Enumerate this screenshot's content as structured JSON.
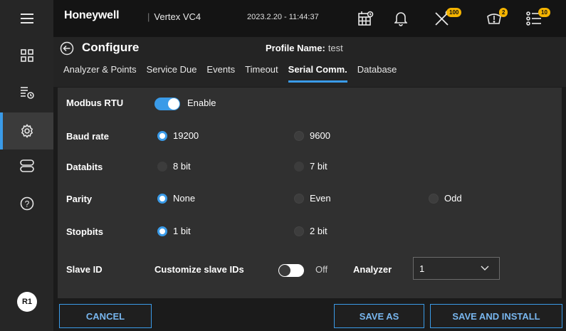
{
  "topbar": {
    "brand": "Honeywell",
    "model": "Vertex VC4",
    "datetime": "2023.2.20 - 11:44:37",
    "badges": {
      "tools": "100",
      "alarm": "2",
      "list": "10"
    }
  },
  "header": {
    "title": "Configure",
    "profile_label": "Profile Name:",
    "profile_value": "test",
    "tabs": [
      {
        "label": "Analyzer & Points"
      },
      {
        "label": "Service Due"
      },
      {
        "label": "Events"
      },
      {
        "label": "Timeout"
      },
      {
        "label": "Serial Comm.",
        "active": true
      },
      {
        "label": "Database"
      }
    ]
  },
  "form": {
    "modbus": {
      "label": "Modbus RTU",
      "toggle_state": "on",
      "toggle_label": "Enable"
    },
    "baud": {
      "label": "Baud rate",
      "options": [
        "19200",
        "9600"
      ],
      "selected": "19200"
    },
    "databits": {
      "label": "Databits",
      "options": [
        "8 bit",
        "7 bit"
      ],
      "selected": null
    },
    "parity": {
      "label": "Parity",
      "options": [
        "None",
        "Even",
        "Odd"
      ],
      "selected": "None"
    },
    "stopbits": {
      "label": "Stopbits",
      "options": [
        "1 bit",
        "2 bit"
      ],
      "selected": "1 bit"
    },
    "slave": {
      "label": "Slave ID",
      "customize_label": "Customize slave IDs",
      "toggle_state": "off",
      "toggle_label": "Off",
      "analyzer_label": "Analyzer",
      "analyzer_value": "1"
    }
  },
  "footer": {
    "cancel": "CANCEL",
    "save_as": "SAVE AS",
    "save_install": "SAVE AND INSTALL"
  },
  "sidebar": {
    "avatar": "R1"
  },
  "colors": {
    "accent": "#3a9be8",
    "badge": "#f5b400",
    "panel": "#303030"
  }
}
